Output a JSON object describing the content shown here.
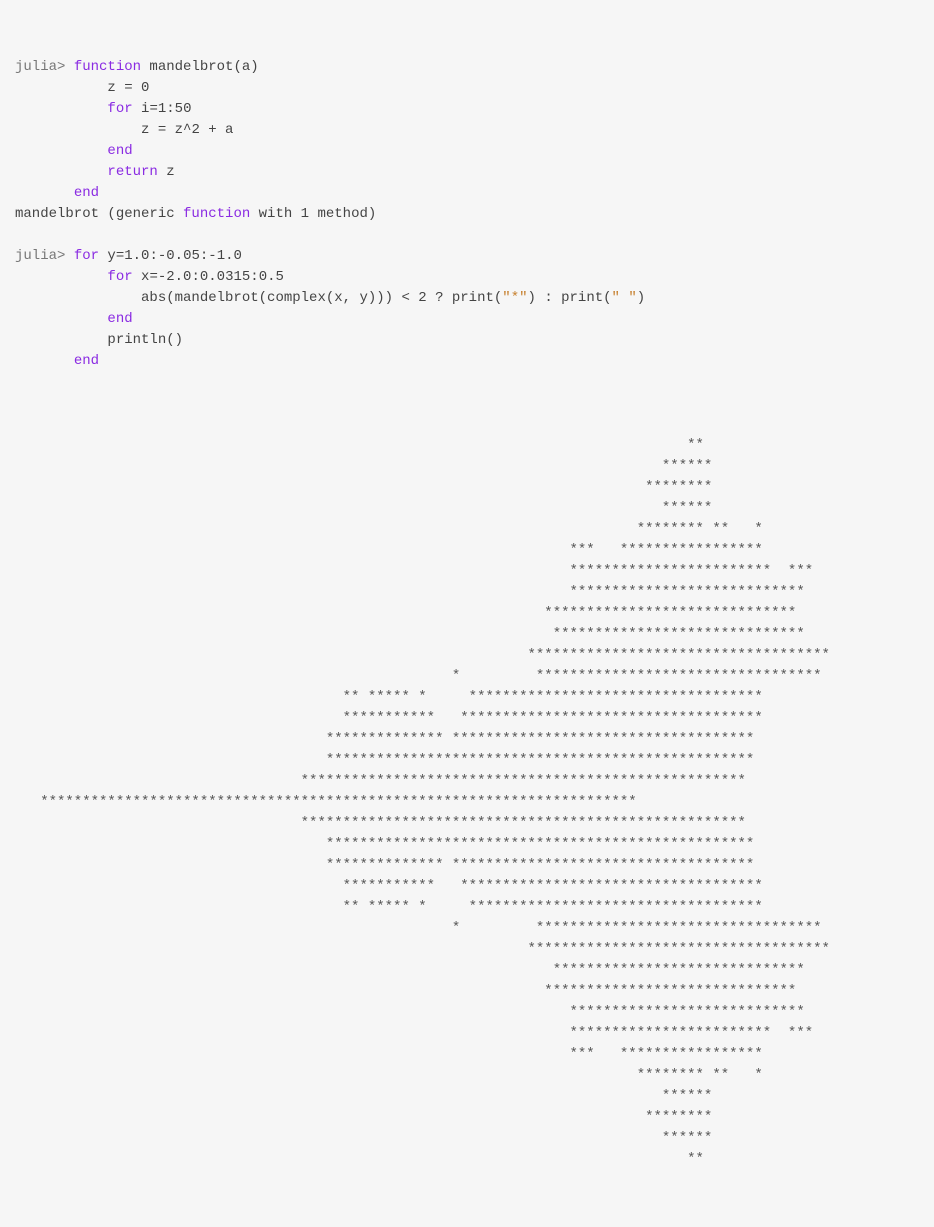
{
  "prompt1": "julia> ",
  "line1_kw": "function",
  "line1_rest": " mandelbrot(a)",
  "line2_indent": "           z = ",
  "line2_num": "0",
  "line3_indent": "           ",
  "line3_kw": "for",
  "line3_rest": " i=",
  "line3_num1": "1",
  "line3_colon": ":",
  "line3_num2": "50",
  "line4": "               z = z^",
  "line4_num": "2",
  "line4_rest": " + a",
  "line5_indent": "           ",
  "line5_kw": "end",
  "line6_indent": "           ",
  "line6_kw": "return",
  "line6_rest": " z",
  "line7_indent": "       ",
  "line7_kw": "end",
  "result1_a": "mandelbrot (generic ",
  "result1_kw": "function",
  "result1_b": " with ",
  "result1_num": "1",
  "result1_c": " method)",
  "blank": "",
  "prompt2": "julia> ",
  "p2_kw": "for",
  "p2_rest": " y=",
  "p2_n1": "1.0",
  "p2_c1": ":-",
  "p2_n2": "0.05",
  "p2_c2": ":-",
  "p2_n3": "1.0",
  "l9_indent": "           ",
  "l9_kw": "for",
  "l9_rest": " x=-",
  "l9_n1": "2.0",
  "l9_c1": ":",
  "l9_n2": "0.0315",
  "l9_c2": ":",
  "l9_n3": "0.5",
  "l10_a": "               abs(mandelbrot(complex(x, y))) < ",
  "l10_n": "2",
  "l10_b": " ? print(",
  "l10_s1": "\"*\"",
  "l10_c": ") : print(",
  "l10_s2": "\" \"",
  "l10_d": ")",
  "l11_indent": "           ",
  "l11_kw": "end",
  "l12": "           println()",
  "l13_indent": "       ",
  "l13_kw": "end",
  "output": "\n\n\n                                                                                **\n                                                                             ******\n                                                                           ********\n                                                                             ******\n                                                                          ******** **   *\n                                                                  ***   *****************\n                                                                  ************************  ***\n                                                                  ****************************\n                                                               ******************************\n                                                                ******************************\n                                                             ************************************\n                                                    *         **********************************\n                                       ** ***** *     ***********************************\n                                       ***********   ************************************\n                                     ************** ************************************\n                                     ***************************************************\n                                  *****************************************************\n   ***********************************************************************\n                                  *****************************************************\n                                     ***************************************************\n                                     ************** ************************************\n                                       ***********   ************************************\n                                       ** ***** *     ***********************************\n                                                    *         **********************************\n                                                             ************************************\n                                                                ******************************\n                                                               ******************************\n                                                                  ****************************\n                                                                  ************************  ***\n                                                                  ***   *****************\n                                                                          ******** **   *\n                                                                             ******\n                                                                           ********\n                                                                             ******\n                                                                                **"
}
